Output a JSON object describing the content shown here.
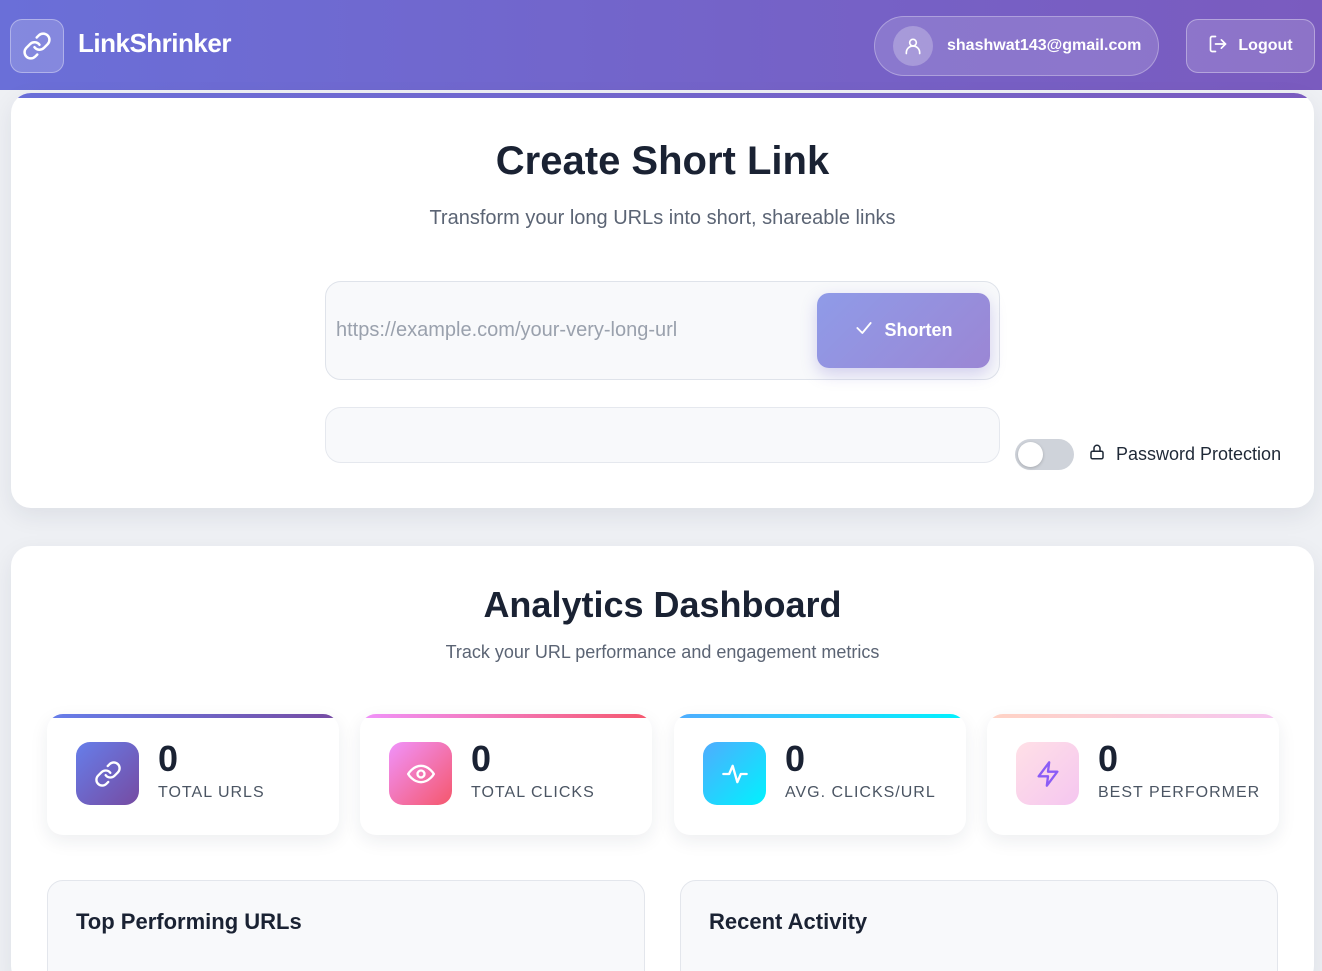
{
  "header": {
    "brand": "LinkShrinker",
    "user_email": "shashwat143@gmail.com",
    "logout_label": "Logout"
  },
  "create": {
    "title": "Create Short Link",
    "subtitle": "Transform your long URLs into short, shareable links",
    "url_placeholder": "https://example.com/your-very-long-url",
    "url_value": "",
    "shorten_label": "Shorten",
    "alias_value": "",
    "password_label": "Password Protection",
    "password_enabled": false
  },
  "dashboard": {
    "title": "Analytics Dashboard",
    "subtitle": "Track your URL performance and engagement metrics",
    "stats": [
      {
        "value": "0",
        "label": "TOTAL URLS",
        "icon": "link-icon",
        "color_from": "#667eea",
        "color_to": "#764ba2"
      },
      {
        "value": "0",
        "label": "TOTAL CLICKS",
        "icon": "eye-icon",
        "color_from": "#f093fb",
        "color_to": "#f5576c"
      },
      {
        "value": "0",
        "label": "AVG. CLICKS/URL",
        "icon": "activity-icon",
        "color_from": "#4facfe",
        "color_to": "#00f2fe"
      },
      {
        "value": "0",
        "label": "BEST PERFORMER",
        "icon": "lightning-icon",
        "color_from": "#ffd3e0",
        "color_to": "#f5c6f0"
      }
    ],
    "top_urls_title": "Top Performing URLs",
    "recent_activity_title": "Recent Activity"
  }
}
